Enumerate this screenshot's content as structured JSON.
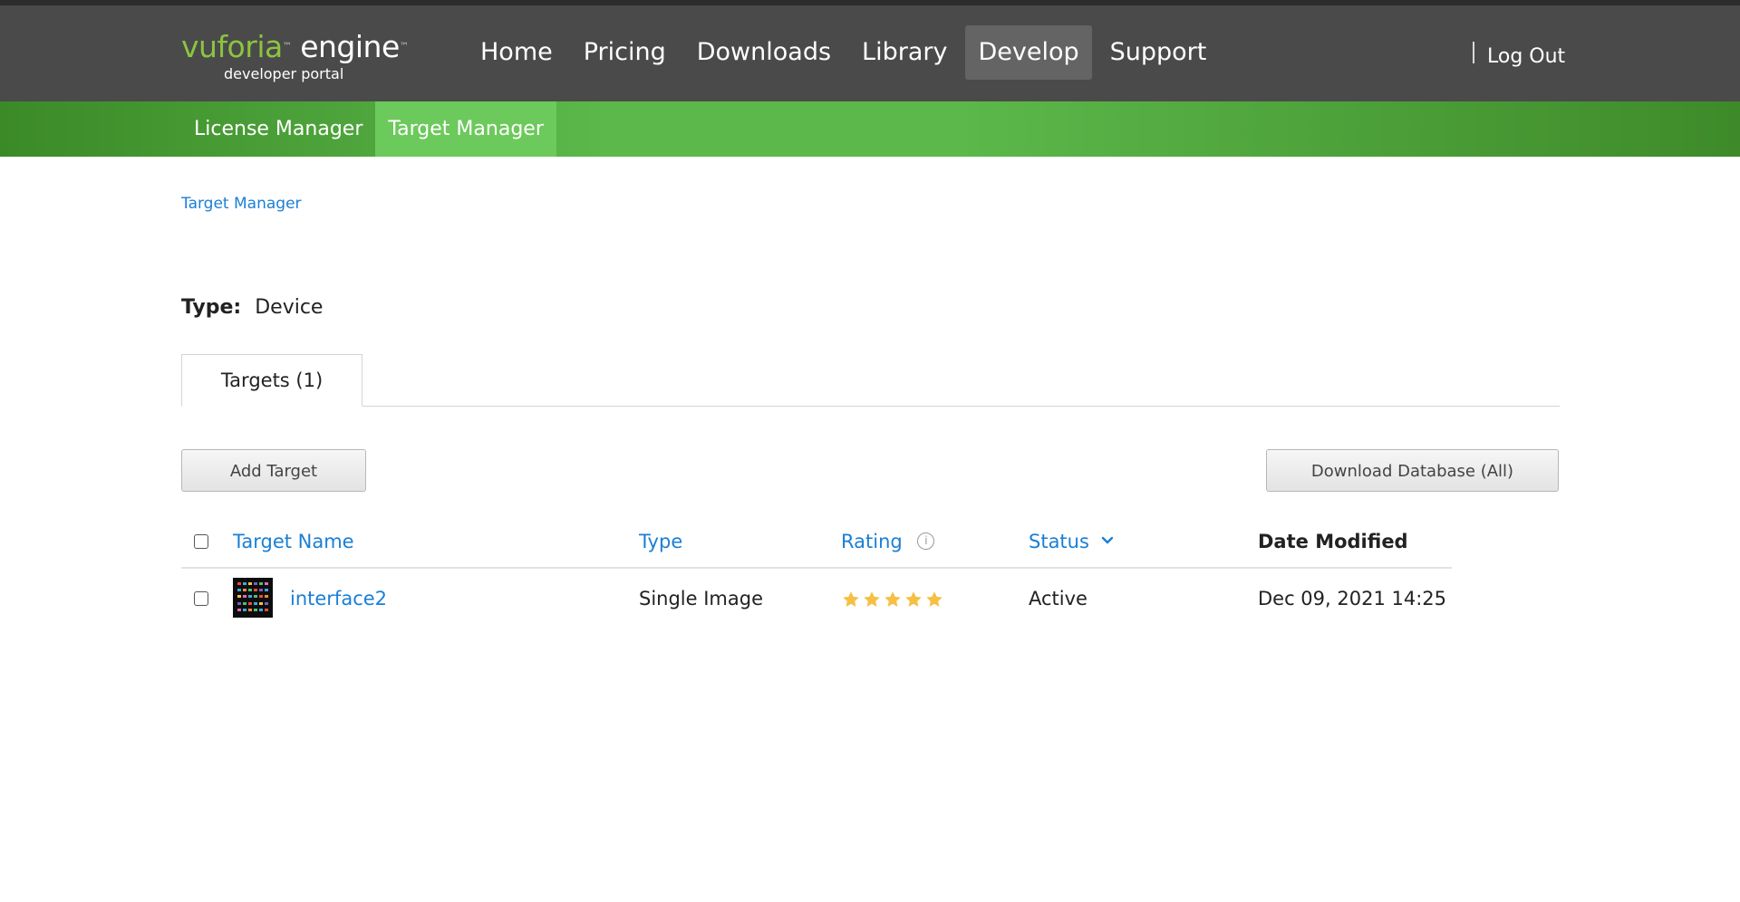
{
  "header": {
    "logo": {
      "brand": "vuforia",
      "product": "engine",
      "tm": "™",
      "subtitle": "developer portal"
    },
    "nav": [
      {
        "label": "Home",
        "active": false
      },
      {
        "label": "Pricing",
        "active": false
      },
      {
        "label": "Downloads",
        "active": false
      },
      {
        "label": "Library",
        "active": false
      },
      {
        "label": "Develop",
        "active": true
      },
      {
        "label": "Support",
        "active": false
      }
    ],
    "logout": "Log Out"
  },
  "subnav": [
    {
      "label": "License Manager",
      "active": false
    },
    {
      "label": "Target Manager",
      "active": true
    }
  ],
  "breadcrumb": "Target Manager",
  "database": {
    "type_label": "Type:",
    "type_value": "Device"
  },
  "tabs": [
    {
      "label": "Targets (1)"
    }
  ],
  "buttons": {
    "add_target": "Add Target",
    "download_database": "Download Database (All)"
  },
  "table": {
    "headers": {
      "name": "Target Name",
      "type": "Type",
      "rating": "Rating",
      "status": "Status",
      "date": "Date Modified"
    },
    "rows": [
      {
        "name": "interface2",
        "type": "Single Image",
        "rating": 5,
        "rating_max": 5,
        "status": "Active",
        "date": "Dec 09, 2021 14:25"
      }
    ]
  },
  "colors": {
    "topbar": "#4a4a4a",
    "subbar_green": "#5cb84a",
    "link_blue": "#1a7fd6",
    "star": "#f5c044",
    "logo_green": "#8cc43f"
  }
}
